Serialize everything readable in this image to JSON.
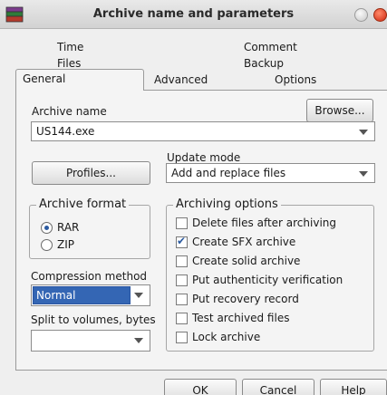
{
  "window": {
    "title": "Archive name and parameters"
  },
  "tabs": {
    "row1": [
      "Time",
      "Comment"
    ],
    "row2": [
      "Files",
      "Backup"
    ],
    "row3": [
      "General",
      "Advanced",
      "Options"
    ],
    "active": "General"
  },
  "archive_name": {
    "label": "Archive name",
    "value": "US144.exe",
    "browse_label": "Browse..."
  },
  "update_mode": {
    "label": "Update mode",
    "value": "Add and replace files"
  },
  "profiles_label": "Profiles...",
  "archive_format": {
    "legend": "Archive format",
    "options": [
      "RAR",
      "ZIP"
    ],
    "selected": "RAR"
  },
  "compression": {
    "label": "Compression method",
    "value": "Normal"
  },
  "split": {
    "label": "Split to volumes, bytes",
    "value": ""
  },
  "archiving_options": {
    "legend": "Archiving options",
    "items": [
      {
        "label": "Delete files after archiving",
        "checked": false
      },
      {
        "label": "Create SFX archive",
        "checked": true
      },
      {
        "label": "Create solid archive",
        "checked": false
      },
      {
        "label": "Put authenticity verification",
        "checked": false
      },
      {
        "label": "Put recovery record",
        "checked": false
      },
      {
        "label": "Test archived files",
        "checked": false
      },
      {
        "label": "Lock archive",
        "checked": false
      }
    ]
  },
  "buttons": {
    "ok": "OK",
    "cancel": "Cancel",
    "help": "Help"
  }
}
